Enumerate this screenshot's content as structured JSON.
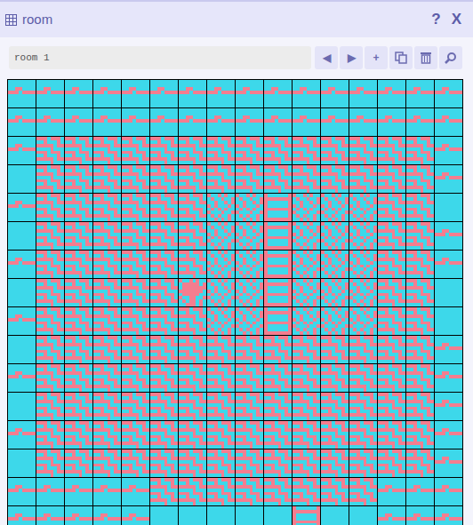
{
  "window": {
    "title": "room",
    "help": "?",
    "close": "X"
  },
  "toolbar": {
    "name": "room 1",
    "buttons": [
      "◀",
      "▶",
      "+"
    ]
  },
  "map": {
    "rows": [
      [
        "wave",
        "wave",
        "wave",
        "wave",
        "wave",
        "wave",
        "wave",
        "wave",
        "wave",
        "wave",
        "wave",
        "wave",
        "wave",
        "wave",
        "wave",
        "wave"
      ],
      [
        "wave",
        "wave",
        "wave",
        "wave",
        "wave",
        "wave",
        "wave",
        "wave",
        "wave",
        "wave",
        "wave",
        "wave",
        "wave",
        "wave",
        "wave",
        "wave"
      ],
      [
        "wave",
        "brick",
        "brick",
        "brick",
        "brick",
        "brick",
        "brick",
        "brick",
        "brick",
        "brick",
        "brick",
        "brick",
        "brick",
        "brick",
        "brick",
        "wave"
      ],
      [
        "empty",
        "brick",
        "brick",
        "brick",
        "brick",
        "brick",
        "brick",
        "brick",
        "brick",
        "brick",
        "brick",
        "brick",
        "brick",
        "brick",
        "brick",
        "wave"
      ],
      [
        "wave",
        "brick",
        "brick",
        "brick",
        "brick",
        "brick",
        "brick",
        "dots",
        "dots",
        "ladder",
        "dots",
        "dots",
        "dots",
        "brick",
        "brick",
        "empty"
      ],
      [
        "empty",
        "brick",
        "brick",
        "brick",
        "brick",
        "brick",
        "brick",
        "dots",
        "dots",
        "ladder",
        "dots",
        "dots",
        "dots",
        "brick",
        "brick",
        "wave"
      ],
      [
        "wave",
        "brick",
        "brick",
        "brick",
        "brick",
        "brick",
        "brick",
        "dots",
        "dots",
        "ladder",
        "dots",
        "dots",
        "dots",
        "brick",
        "brick",
        "wave"
      ],
      [
        "empty",
        "brick",
        "brick",
        "brick",
        "brick",
        "brick",
        "player",
        "dots",
        "dots",
        "ladder",
        "dots",
        "dots",
        "dots",
        "brick",
        "brick",
        "empty"
      ],
      [
        "wave",
        "brick",
        "brick",
        "brick",
        "brick",
        "brick",
        "brick",
        "dots",
        "dots",
        "ladder",
        "dots",
        "dots",
        "dots",
        "brick",
        "brick",
        "empty"
      ],
      [
        "empty",
        "brick",
        "brick",
        "brick",
        "brick",
        "brick",
        "brick",
        "brick",
        "brick",
        "brick",
        "brick",
        "brick",
        "brick",
        "brick",
        "brick",
        "wave"
      ],
      [
        "wave",
        "brick",
        "brick",
        "brick",
        "brick",
        "brick",
        "brick",
        "brick",
        "brick",
        "brick",
        "brick",
        "brick",
        "brick",
        "brick",
        "brick",
        "wave"
      ],
      [
        "empty",
        "brick",
        "brick",
        "brick",
        "brick",
        "brick",
        "brick",
        "brick",
        "brick",
        "brick",
        "brick",
        "brick",
        "brick",
        "brick",
        "brick",
        "wave"
      ],
      [
        "wave",
        "brick",
        "brick",
        "brick",
        "brick",
        "brick",
        "brick",
        "brick",
        "brick",
        "brick",
        "brick",
        "brick",
        "brick",
        "brick",
        "brick",
        "wave"
      ],
      [
        "empty",
        "brick",
        "brick",
        "brick",
        "brick",
        "brick",
        "brick",
        "brick",
        "brick",
        "brick",
        "brick",
        "brick",
        "brick",
        "brick",
        "brick",
        "wave"
      ],
      [
        "wave",
        "wave",
        "wave",
        "wave",
        "wave",
        "brick",
        "brick",
        "brick",
        "brick",
        "brick",
        "brick",
        "brick",
        "brick",
        "wave",
        "wave",
        "wave"
      ],
      [
        "wave",
        "wave",
        "wave",
        "wave",
        "wave",
        "empty",
        "empty",
        "empty",
        "empty",
        "empty",
        "ladder",
        "empty",
        "empty",
        "wave",
        "wave",
        "wave"
      ]
    ]
  }
}
